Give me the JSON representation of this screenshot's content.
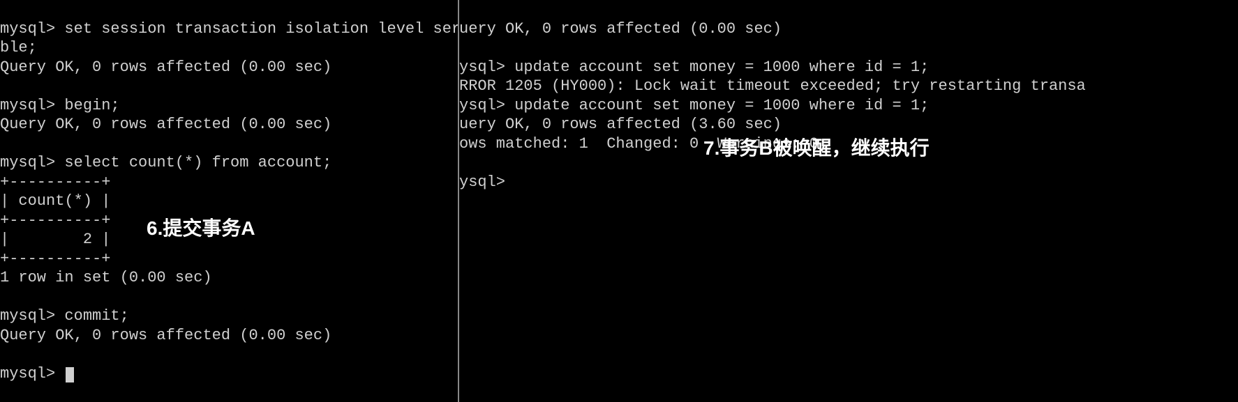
{
  "left": {
    "lines": [
      "mysql> set session transaction isolation level serializa",
      "ble;",
      "Query OK, 0 rows affected (0.00 sec)",
      "",
      "mysql> begin;",
      "Query OK, 0 rows affected (0.00 sec)",
      "",
      "mysql> select count(*) from account;",
      "+----------+",
      "| count(*) |",
      "+----------+",
      "|        2 |",
      "+----------+",
      "1 row in set (0.00 sec)",
      "",
      "mysql> commit;",
      "Query OK, 0 rows affected (0.00 sec)",
      "",
      "mysql> "
    ],
    "annotation": "6.提交事务A"
  },
  "right": {
    "lines": [
      "uery OK, 0 rows affected (0.00 sec)",
      "",
      "ysql> update account set money = 1000 where id = 1;",
      "RROR 1205 (HY000): Lock wait timeout exceeded; try restarting transa",
      "ysql> update account set money = 1000 where id = 1;",
      "uery OK, 0 rows affected (3.60 sec)",
      "ows matched: 1  Changed: 0  Warnings: 0",
      "",
      "ysql>"
    ],
    "annotation": "7.事务B被唤醒，继续执行"
  }
}
